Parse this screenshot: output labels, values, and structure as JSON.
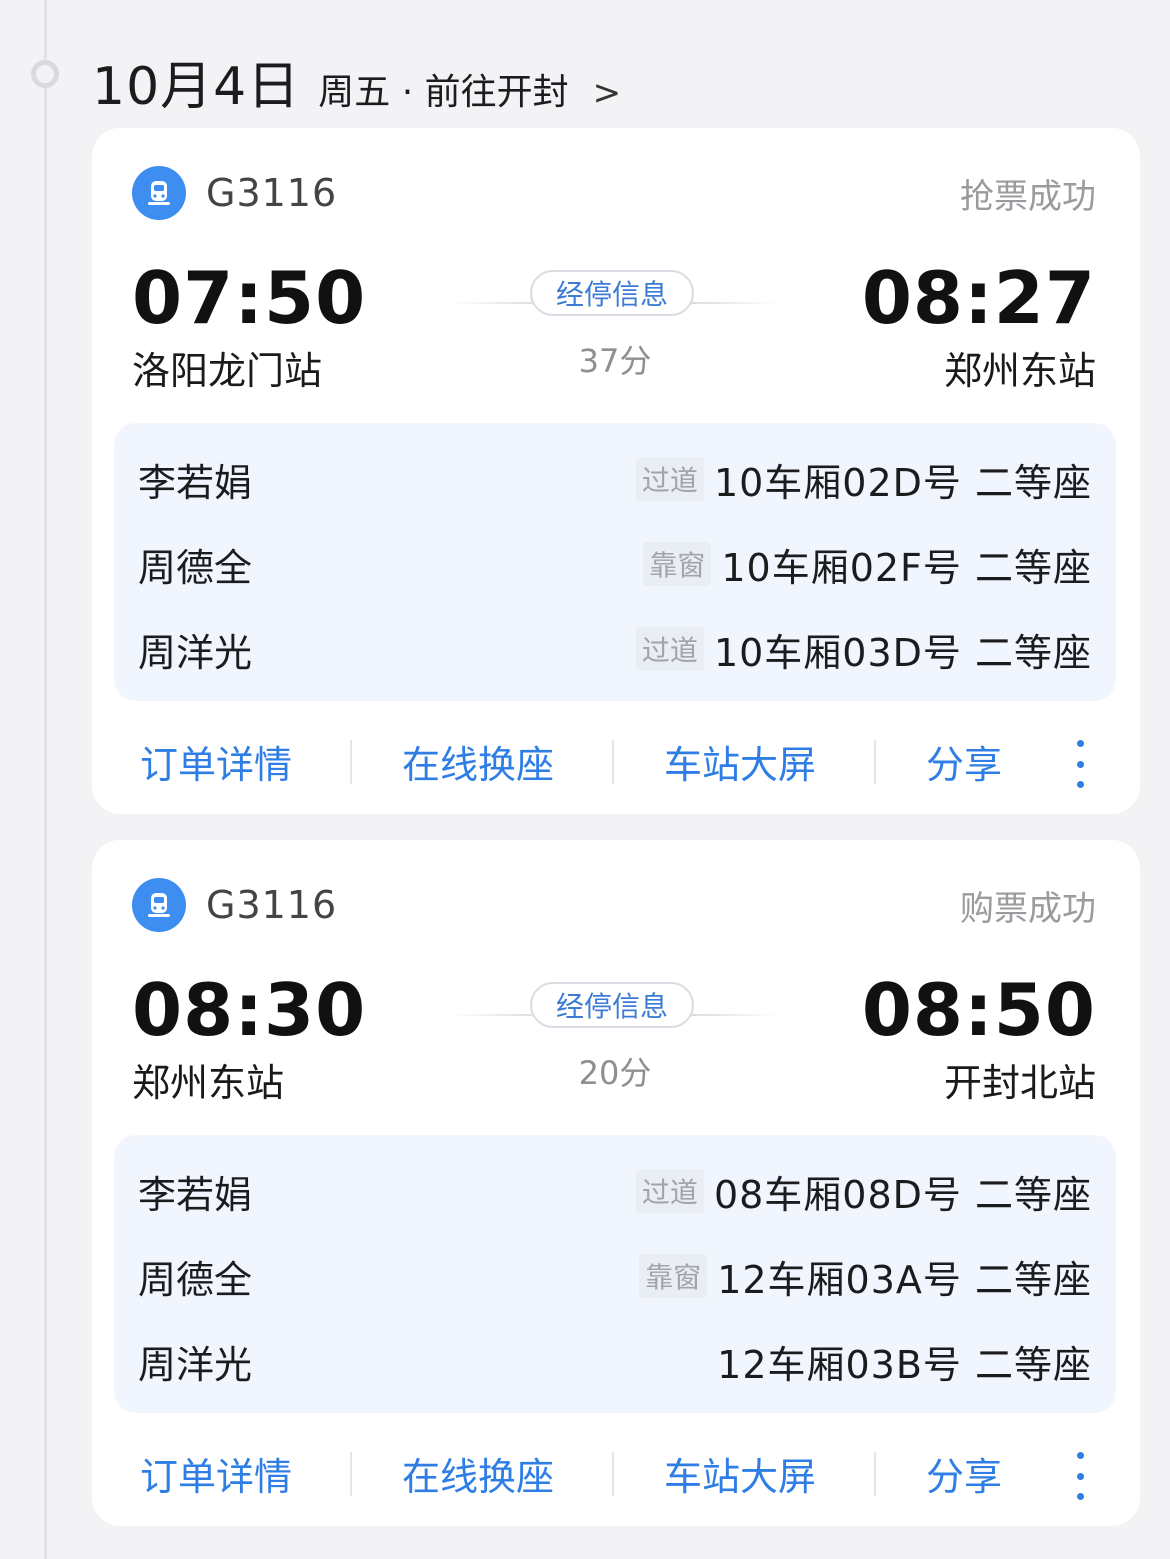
{
  "header": {
    "date": "10月4日",
    "subtitle": "周五 · 前往开封",
    "arrow": ">"
  },
  "colors": {
    "accent": "#2f7ee6",
    "panel": "#f1f6fe",
    "icon_bg": "#3d8ef0"
  },
  "cards": [
    {
      "train_no": "G3116",
      "status": "抢票成功",
      "dep_time": "07:50",
      "dep_station": "洛阳龙门站",
      "arr_time": "08:27",
      "arr_station": "郑州东站",
      "stops_label": "经停信息",
      "duration": "37分",
      "passengers": [
        {
          "name": "李若娟",
          "tag": "过道",
          "seat": "10车厢02D号 二等座"
        },
        {
          "name": "周德全",
          "tag": "靠窗",
          "seat": "10车厢02F号 二等座"
        },
        {
          "name": "周洋光",
          "tag": "过道",
          "seat": "10车厢03D号 二等座"
        }
      ],
      "actions": [
        "订单详情",
        "在线换座",
        "车站大屏",
        "分享"
      ]
    },
    {
      "train_no": "G3116",
      "status": "购票成功",
      "dep_time": "08:30",
      "dep_station": "郑州东站",
      "arr_time": "08:50",
      "arr_station": "开封北站",
      "stops_label": "经停信息",
      "duration": "20分",
      "passengers": [
        {
          "name": "李若娟",
          "tag": "过道",
          "seat": "08车厢08D号 二等座"
        },
        {
          "name": "周德全",
          "tag": "靠窗",
          "seat": "12车厢03A号 二等座"
        },
        {
          "name": "周洋光",
          "tag": "",
          "seat": "12车厢03B号 二等座"
        }
      ],
      "actions": [
        "订单详情",
        "在线换座",
        "车站大屏",
        "分享"
      ]
    }
  ]
}
